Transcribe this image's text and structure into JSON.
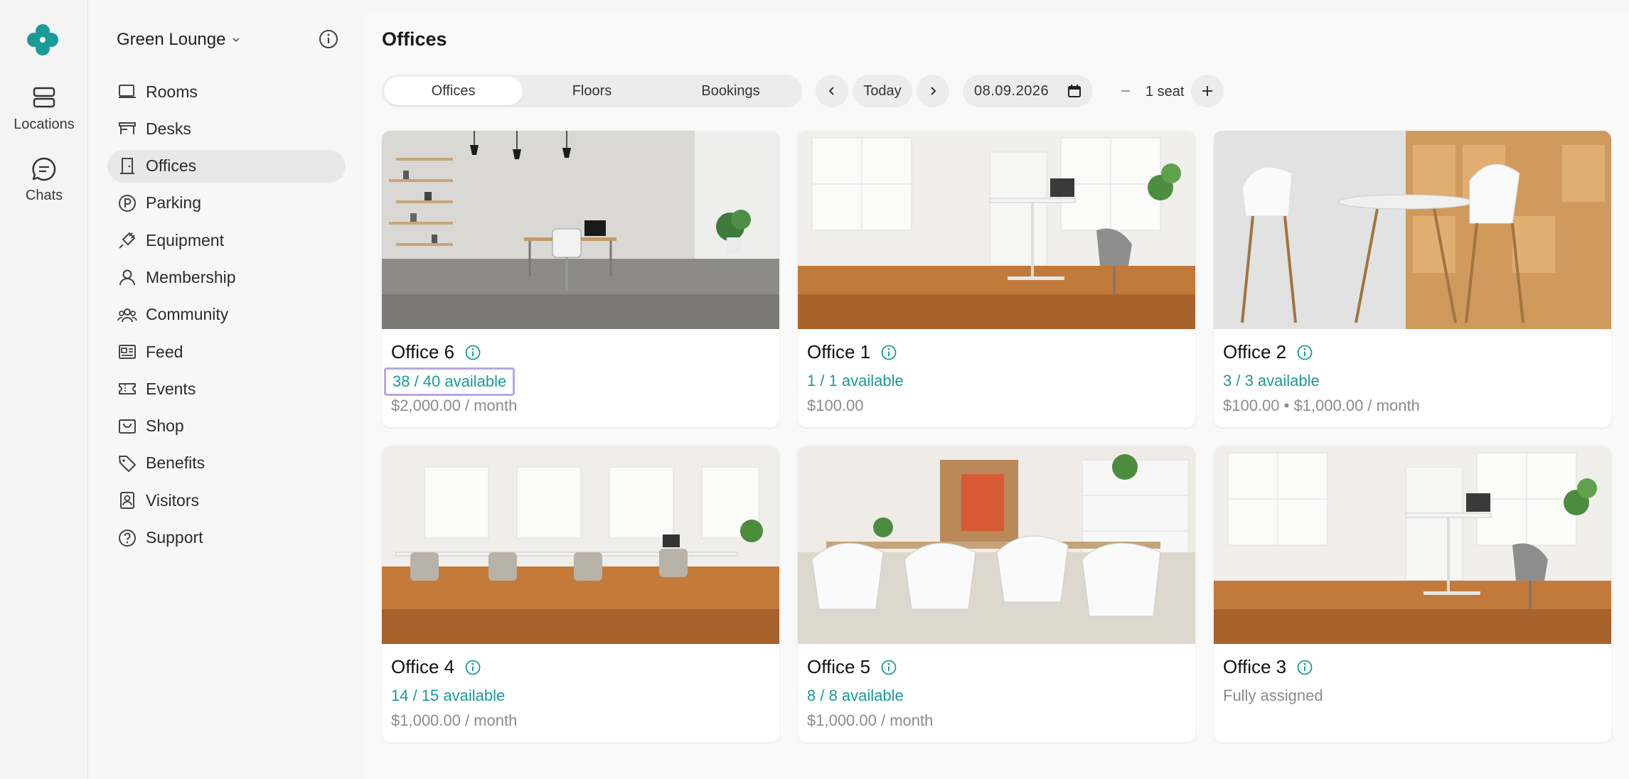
{
  "rail": {
    "items": [
      {
        "label": "Locations",
        "icon": "locations-icon"
      },
      {
        "label": "Chats",
        "icon": "chat-icon"
      }
    ],
    "brand_color": "#1a9a98"
  },
  "sidebar": {
    "location_name": "Green Lounge",
    "items": [
      {
        "label": "Rooms",
        "icon": "room-icon",
        "active": false
      },
      {
        "label": "Desks",
        "icon": "desk-icon",
        "active": false
      },
      {
        "label": "Offices",
        "icon": "office-icon",
        "active": true
      },
      {
        "label": "Parking",
        "icon": "parking-icon",
        "active": false
      },
      {
        "label": "Equipment",
        "icon": "plug-icon",
        "active": false
      },
      {
        "label": "Membership",
        "icon": "person-icon",
        "active": false
      },
      {
        "label": "Community",
        "icon": "community-icon",
        "active": false
      },
      {
        "label": "Feed",
        "icon": "feed-icon",
        "active": false
      },
      {
        "label": "Events",
        "icon": "ticket-icon",
        "active": false
      },
      {
        "label": "Shop",
        "icon": "shop-icon",
        "active": false
      },
      {
        "label": "Benefits",
        "icon": "tag-icon",
        "active": false
      },
      {
        "label": "Visitors",
        "icon": "visitor-badge-icon",
        "active": false
      },
      {
        "label": "Support",
        "icon": "help-icon",
        "active": false
      }
    ]
  },
  "main": {
    "title": "Offices",
    "tabs": [
      {
        "label": "Offices",
        "active": true
      },
      {
        "label": "Floors",
        "active": false
      },
      {
        "label": "Bookings",
        "active": false
      }
    ],
    "today_label": "Today",
    "date_value": "08.09.2026",
    "seats_label": "1 seat",
    "accent_color": "#199a98",
    "highlight_color": "#b4a7ea"
  },
  "cards": [
    {
      "title": "Office 6",
      "availability": "38 / 40 available",
      "price": "$2,000.00 / month",
      "highlighted": true,
      "photo": "minimal office with shelves and pendant lamps"
    },
    {
      "title": "Office 1",
      "availability": "1 / 1 available",
      "price": "$100.00",
      "highlighted": false,
      "photo": "bright room with standing desk"
    },
    {
      "title": "Office 2",
      "availability": "3 / 3 available",
      "price": "$100.00 • $1,000.00 / month",
      "highlighted": false,
      "photo": "white chairs around round table"
    },
    {
      "title": "Office 4",
      "availability": "14 / 15 available",
      "price": "$1,000.00 / month",
      "highlighted": false,
      "photo": "open space with many desks"
    },
    {
      "title": "Office 5",
      "availability": "8 / 8 available",
      "price": "$1,000.00 / month",
      "highlighted": false,
      "photo": "meeting table with white chairs"
    },
    {
      "title": "Office 3",
      "availability": "Fully assigned",
      "price": "",
      "highlighted": false,
      "photo": "bright room with standing desk"
    }
  ]
}
